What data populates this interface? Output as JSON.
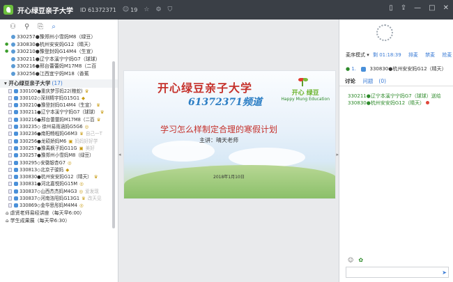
{
  "titlebar": {
    "app_title": "开心绿豆亲子大学",
    "room_id": "ID 61372371",
    "member_count": "19"
  },
  "left": {
    "top_rows": [
      {
        "id": "330257",
        "name": "豫郑州小雪妈M8（绿豆）",
        "mark": ""
      },
      {
        "id": "330830",
        "name": "杭州安安妈G12（晴天）",
        "mark": "●"
      },
      {
        "id": "330210",
        "name": "豫登封妈G14M4（生宣）",
        "mark": "●"
      },
      {
        "id": "330211",
        "name": "辽宁本溪宁宁妈G7（球球）",
        "mark": ""
      },
      {
        "id": "330216",
        "name": "邢台蕾蕾妈M17M8（二百",
        "mark": ""
      },
      {
        "id": "330256",
        "name": "江西宜宁妈M18（香蕉",
        "mark": ""
      }
    ],
    "group_title": "开心绿豆亲子大学",
    "group_count": "(17)",
    "members": [
      {
        "name": "330100●重庆梦莎妈22(粮蛇)",
        "badge": "♛",
        "tag": ""
      },
      {
        "name": "330102◇深圳精宇妈G15G1",
        "badge": "◆",
        "tag": ""
      },
      {
        "name": "330210●豫登封妈G14M4（生宣）",
        "badge": "♛",
        "tag": ""
      },
      {
        "name": "330211●辽宁本溪宁宁妈G7（球球）",
        "badge": "♛",
        "tag": ""
      },
      {
        "name": "330216●邢台蕾蕾妈M17M8（二百",
        "badge": "♛",
        "tag": ""
      },
      {
        "name": "330235◇ 徐州易雨涵妈G5G6",
        "badge": "◎",
        "tag": ""
      },
      {
        "name": "330236●南阳畅程妈G6M3",
        "badge": "♛",
        "tag": "自己一T"
      },
      {
        "name": "330256●龙硕娇妈M6",
        "badge": "▣",
        "tag": "妈妈好好学"
      },
      {
        "name": "330257●豫禹枫子妈G11G",
        "badge": "▣",
        "tag": "美好"
      },
      {
        "name": "330257●豫郑州小雪妈M8（绿豆）",
        "badge": "",
        "tag": ""
      },
      {
        "name": "330295◇安徽银杏G7",
        "badge": "◎",
        "tag": ""
      },
      {
        "name": "330813◇北京子骏妈",
        "badge": "◆",
        "tag": ""
      },
      {
        "name": "330830●杭州安安妈G12（晴天）",
        "badge": "♛",
        "tag": ""
      },
      {
        "name": "330831●河北嘉悦妈G15M",
        "badge": "◎",
        "tag": ""
      },
      {
        "name": "330837◇山西杰杰妈M4G3",
        "badge": "◎",
        "tag": "爱发现"
      },
      {
        "name": "330837◇河南洛阳妈G13G1",
        "badge": "♛",
        "tag": "改天见"
      },
      {
        "name": "330869◇金华思彤妈M4M4",
        "badge": "◎",
        "tag": ""
      }
    ],
    "bottom_groups": [
      "虐贤老师易经讲座（每天早6:00）",
      "学生成果展（每天早6:30）"
    ]
  },
  "slide": {
    "title": "开心绿豆亲子大学",
    "channel": "61372371频道",
    "brand_cn": "开心",
    "brand_cn2": "绿豆",
    "brand_en": "Happy Mung Education",
    "subject": "学习怎么样制定合理的寒假计划",
    "speaker": "主讲：晴天老师",
    "date": "2018年1月10日"
  },
  "right": {
    "mic_mode": "麦序模式",
    "timer": "剩 01:18:39",
    "actions": [
      "排麦",
      "禁麦",
      "抢麦"
    ],
    "queue_num": "1.",
    "queue_name": "330830●杭州安安妈G12（晴天）",
    "tab_discussion": "讨论",
    "tab_question": "问题",
    "tab_question_count": "(0)",
    "chat_text": "330211●辽宁本溪宁宁妈G7（球球）送给 330830●杭州安安妈G12（晴天）"
  }
}
